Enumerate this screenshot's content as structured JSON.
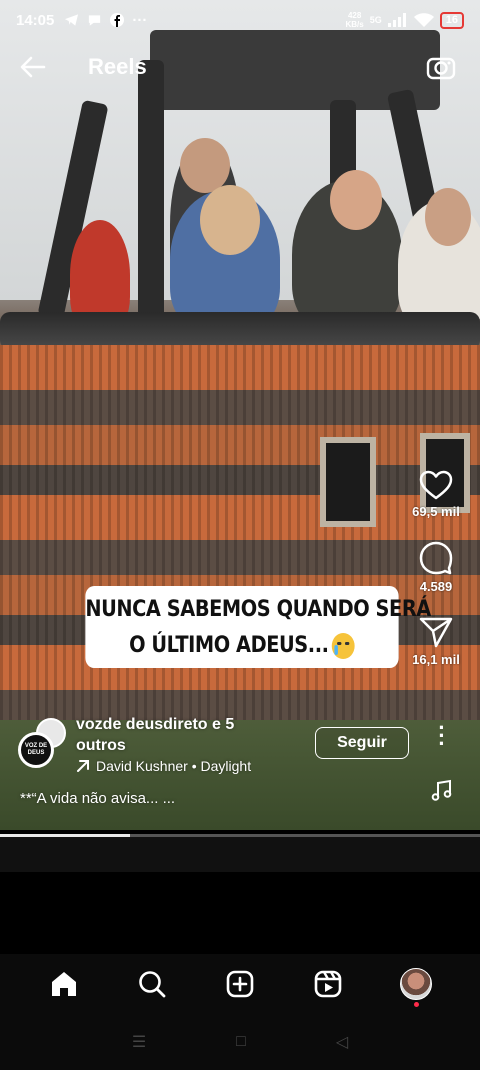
{
  "status_bar": {
    "time": "14:05",
    "net_speed_value": "428",
    "net_speed_unit": "KB/s",
    "network": "5G",
    "battery": "16"
  },
  "header": {
    "title": "Reels",
    "back_icon": "arrow-left-icon",
    "camera_icon": "camera-icon"
  },
  "video": {
    "caption_line1": "NUNCA SABEMOS QUANDO SERÁ",
    "caption_line2": "O ÚLTIMO ADEUS...",
    "caption_emoji": "crying-face-emoji"
  },
  "actions": {
    "likes": "69,5 mil",
    "comments": "4.589",
    "shares": "16,1 mil"
  },
  "post": {
    "author_line1": "vozde deusdireto e 5",
    "author_line2": "outros",
    "avatar_text": "VOZ DE DEUS",
    "music": "David Kushner • Daylight",
    "follow_label": "Seguir",
    "description": "**“A vida não avisa... ..."
  },
  "progress": {
    "fraction": 0.27
  },
  "bottom_nav": {
    "items": [
      "home-icon",
      "search-icon",
      "create-icon",
      "reels-icon",
      "profile-avatar"
    ]
  },
  "colors": {
    "accent_red": "#ff2b4a",
    "battery_red": "#e53935"
  }
}
